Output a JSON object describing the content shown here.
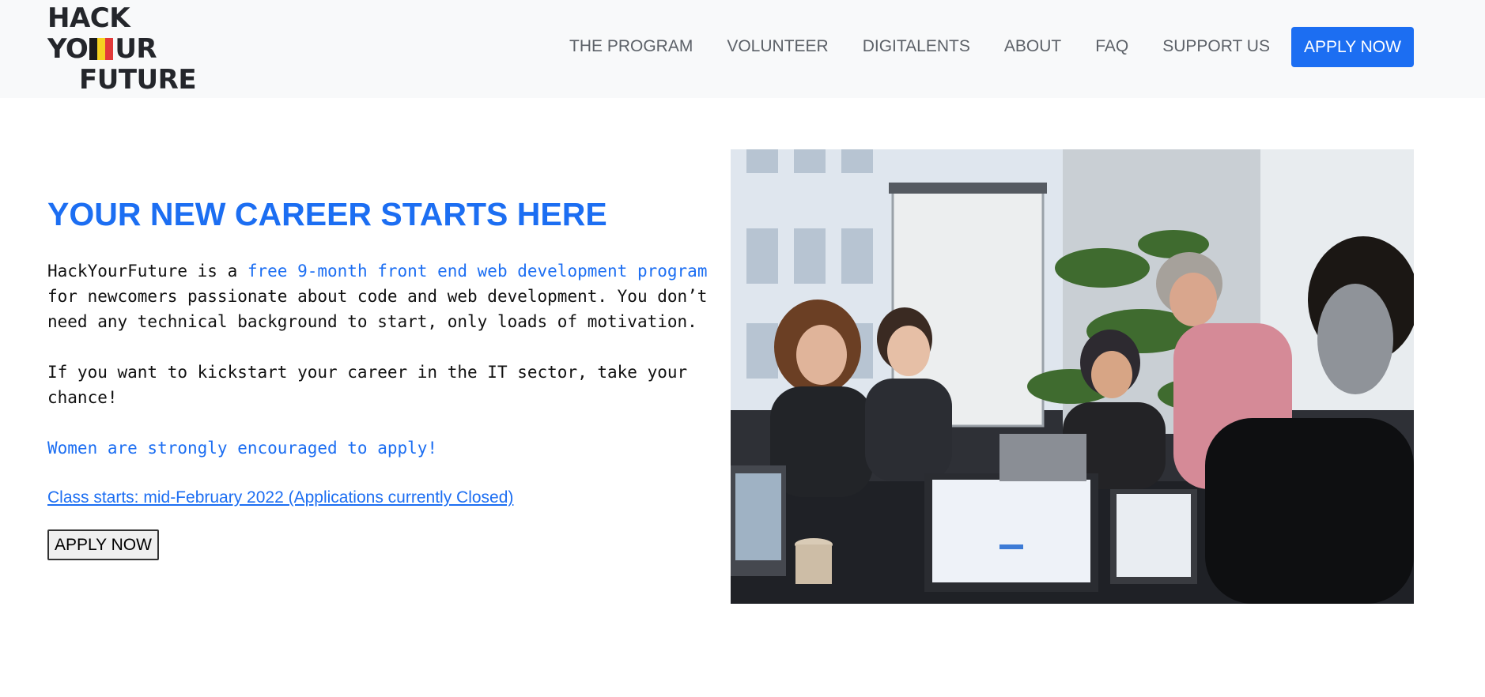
{
  "logo": {
    "line1": "HACK",
    "line2_left": "YO",
    "line2_right": "UR",
    "line3": "FUTURE"
  },
  "nav": {
    "items": [
      {
        "label": "THE PROGRAM"
      },
      {
        "label": "VOLUNTEER"
      },
      {
        "label": "DIGITALENTS"
      },
      {
        "label": "ABOUT"
      },
      {
        "label": "FAQ"
      },
      {
        "label": "SUPPORT US"
      }
    ],
    "apply_label": "APPLY NOW"
  },
  "hero": {
    "title": "YOUR NEW CAREER STARTS HERE",
    "intro_prefix": "HackYourFuture is a ",
    "intro_highlight": "free 9-month front end web development program",
    "intro_suffix": " for newcomers passionate about code and web development. You don’t need any technical background to start, only loads of motivation.",
    "kickstart": "If you want to kickstart your career in the IT sector, take your chance!",
    "women": "Women are strongly encouraged to apply!",
    "class_link": "Class starts: mid-February 2022 (Applications currently Closed)",
    "apply_button": "APPLY NOW"
  },
  "colors": {
    "accent": "#1c6ef2",
    "header_bg": "#f8f9fa",
    "nav_text": "#5c6168",
    "flag_black": "#1b1b1b",
    "flag_yellow": "#f5d320",
    "flag_red": "#e23a3a"
  }
}
